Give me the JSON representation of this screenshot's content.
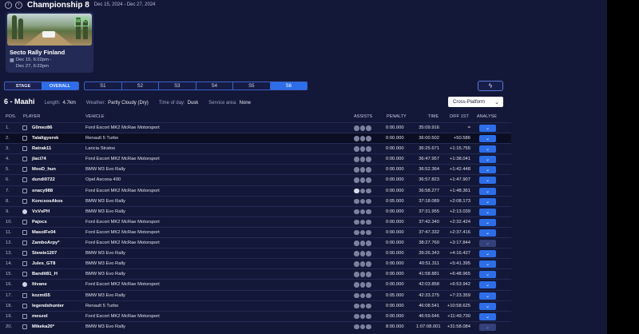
{
  "header": {
    "title": "Championship 8",
    "dates": "Dec 15, 2024 - Dec 27, 2024"
  },
  "event_card": {
    "logo": "WRC",
    "name": "Secto Rally Finland",
    "date_line1": "Dec 15, 6:22pm -",
    "date_line2": "Dec 27, 6:22pm"
  },
  "view_toggle": {
    "stage": "STAGE",
    "overall": "OVERALL",
    "selected": "OVERALL"
  },
  "stage_tabs": [
    "S1",
    "S2",
    "S3",
    "S4",
    "S5",
    "S6"
  ],
  "selected_stage": "S6",
  "stage_info": {
    "name": "6 - Maahi",
    "length_label": "Length:",
    "length": "4.7km",
    "weather_label": "Weather:",
    "weather": "Partly Cloudy (Dry)",
    "time_label": "Time of day:",
    "time": "Dusk",
    "service_label": "Service area:",
    "service": "None"
  },
  "platform_filter": {
    "value": "Cross-Platform"
  },
  "table": {
    "headers": {
      "pos": "POS.",
      "player": "PLAYER",
      "vehicle": "VEHICLE",
      "assists": "ASSISTS",
      "penalty": "PENALTY",
      "time": "TIME",
      "diff": "DIFF 1ST",
      "analyse": "ANALYSE"
    },
    "rows": [
      {
        "pos": "1.",
        "platform": "pc",
        "player": "G0mez86",
        "vehicle": "Ford Escort MK2 McRae Motorsport",
        "penalty": "0:00.000",
        "time": "35:09.916",
        "diff": "="
      },
      {
        "pos": "2.",
        "platform": "pc",
        "player": "Talaltgyerek",
        "vehicle": "Renault 5 Turbo",
        "penalty": "0:00.000",
        "time": "36:00.502",
        "diff": "+50.586",
        "highlight": true
      },
      {
        "pos": "3.",
        "platform": "pc",
        "player": "Ratrak11",
        "vehicle": "Lancia Stratos",
        "penalty": "0:00.000",
        "time": "36:25.671",
        "diff": "+1:15.755"
      },
      {
        "pos": "4.",
        "platform": "pc",
        "player": "jlaci74",
        "vehicle": "Ford Escort MK2 McRae Motorsport",
        "penalty": "0:00.000",
        "time": "36:47.957",
        "diff": "+1:38.041"
      },
      {
        "pos": "5.",
        "platform": "pc",
        "player": "MooD_hun",
        "vehicle": "BMW M3 Evo Rally",
        "penalty": "0:00.000",
        "time": "36:52.364",
        "diff": "+1:42.448"
      },
      {
        "pos": "6.",
        "platform": "pc",
        "player": "dundi0722",
        "vehicle": "Opel Ascona 400",
        "penalty": "0:00.000",
        "time": "36:57.823",
        "diff": "+1:47.907"
      },
      {
        "pos": "7.",
        "platform": "pc",
        "player": "snacy988",
        "vehicle": "Ford Escort MK2 McRae Motorsport",
        "penalty": "0:00.000",
        "time": "36:58.277",
        "diff": "+1:48.361",
        "assist_first_on": true
      },
      {
        "pos": "8.",
        "platform": "pc",
        "player": "KoncsosAkos",
        "vehicle": "BMW M3 Evo Rally",
        "penalty": "0:05.000",
        "time": "37:18.089",
        "diff": "+2:08.173"
      },
      {
        "pos": "9.",
        "platform": "xbox",
        "player": "VxVsPH",
        "vehicle": "BMW M3 Evo Rally",
        "penalty": "0:00.000",
        "time": "37:31.955",
        "diff": "+2:13.039"
      },
      {
        "pos": "10.",
        "platform": "pc",
        "player": "Pajocs",
        "vehicle": "Ford Escort MK2 McRae Motorsport",
        "penalty": "0:00.000",
        "time": "37:42.340",
        "diff": "+2:32.424"
      },
      {
        "pos": "11.",
        "platform": "pc",
        "player": "MasolFe04",
        "vehicle": "Ford Escort MK2 McRae Motorsport",
        "penalty": "0:00.000",
        "time": "37:47.332",
        "diff": "+2:37.416"
      },
      {
        "pos": "12.",
        "platform": "pc",
        "player": "ZamboArpy*",
        "vehicle": "Ford Escort MK2 McRae Motorsport",
        "penalty": "0:00.000",
        "time": "38:27.760",
        "diff": "+3:17.844",
        "analyse_dim": true
      },
      {
        "pos": "13.",
        "platform": "pc",
        "player": "Stewie1207",
        "vehicle": "BMW M3 Evo Rally",
        "penalty": "0:00.000",
        "time": "39:26.343",
        "diff": "+4:16.427"
      },
      {
        "pos": "14.",
        "platform": "pc",
        "player": "Jules_GT8",
        "vehicle": "BMW M3 Evo Rally",
        "penalty": "0:00.000",
        "time": "40:51.311",
        "diff": "+5:41.395"
      },
      {
        "pos": "15.",
        "platform": "pc",
        "player": "Bandit81_H",
        "vehicle": "BMW M3 Evo Rally",
        "penalty": "0:00.000",
        "time": "41:58.881",
        "diff": "+6:48.965"
      },
      {
        "pos": "16.",
        "platform": "xbox",
        "player": "lttvane",
        "vehicle": "Ford Escort MK2 McRae Motorsport",
        "penalty": "0:00.000",
        "time": "42:03.858",
        "diff": "+6:53.942"
      },
      {
        "pos": "17.",
        "platform": "pc",
        "player": "kozmi55",
        "vehicle": "BMW M3 Evo Rally",
        "penalty": "0:05.000",
        "time": "42:33.275",
        "diff": "+7:23.359"
      },
      {
        "pos": "18.",
        "platform": "pc",
        "player": "legendshunter",
        "vehicle": "Renault 5 Turbo",
        "penalty": "0:00.000",
        "time": "46:08.541",
        "diff": "+10:58.625"
      },
      {
        "pos": "19.",
        "platform": "pc",
        "player": "meszol",
        "vehicle": "Ford Escort MK2 McRae Motorsport",
        "penalty": "0:00.000",
        "time": "46:59.646",
        "diff": "+11:49.730"
      },
      {
        "pos": "20.",
        "platform": "pc",
        "player": "Mikeka20*",
        "vehicle": "BMW M3 Evo Rally",
        "penalty": "8:00.000",
        "time": "1:07:08.001",
        "diff": "+31:58.084",
        "analyse_dim": true
      }
    ]
  },
  "colors": {
    "background": "#141838",
    "accent": "#2d6ee8",
    "row_divider": "#232a52"
  }
}
